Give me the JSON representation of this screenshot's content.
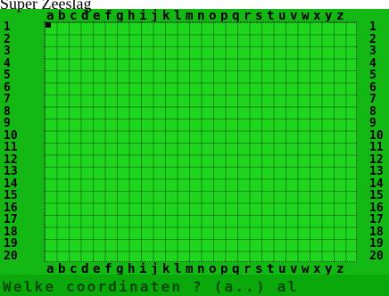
{
  "window": {
    "title": "Super Zeeslag"
  },
  "board": {
    "columns": [
      "a",
      "b",
      "c",
      "d",
      "e",
      "f",
      "g",
      "h",
      "i",
      "j",
      "k",
      "l",
      "m",
      "n",
      "o",
      "p",
      "q",
      "r",
      "s",
      "t",
      "u",
      "v",
      "w",
      "x",
      "y",
      "z"
    ],
    "rows": [
      "1",
      "2",
      "3",
      "4",
      "5",
      "6",
      "7",
      "8",
      "9",
      "10",
      "11",
      "12",
      "13",
      "14",
      "15",
      "16",
      "17",
      "18",
      "19",
      "20"
    ],
    "marker_cell": "a1"
  },
  "prompt": {
    "text": "Welke coordinaten ? (a..) al"
  },
  "colors": {
    "screen": "#14b814",
    "grid": "#1fd61f",
    "text": "#000000"
  }
}
